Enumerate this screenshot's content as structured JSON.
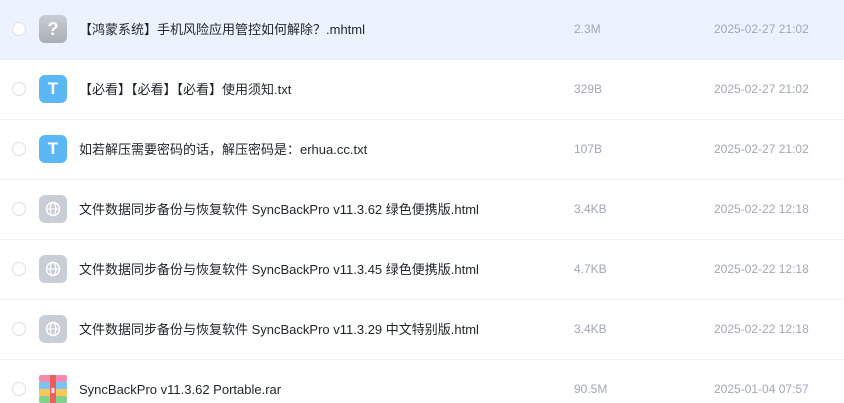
{
  "files": [
    {
      "name": "【鸿蒙系统】手机风险应用管控如何解除？.mhtml",
      "size": "2.3M",
      "date": "2025-02-27 21:02",
      "icon": "unknown-file-icon",
      "icon_glyph": "?"
    },
    {
      "name": "【必看】【必看】【必看】使用须知.txt",
      "size": "329B",
      "date": "2025-02-27 21:02",
      "icon": "txt-file-icon",
      "icon_glyph": "T"
    },
    {
      "name": "如若解压需要密码的话，解压密码是：erhua.cc.txt",
      "size": "107B",
      "date": "2025-02-27 21:02",
      "icon": "txt-file-icon",
      "icon_glyph": "T"
    },
    {
      "name": "文件数据同步备份与恢复软件 SyncBackPro v11.3.62 绿色便携版.html",
      "size": "3.4KB",
      "date": "2025-02-22 12:18",
      "icon": "html-file-icon"
    },
    {
      "name": "文件数据同步备份与恢复软件 SyncBackPro v11.3.45 绿色便携版.html",
      "size": "4.7KB",
      "date": "2025-02-22 12:18",
      "icon": "html-file-icon"
    },
    {
      "name": "文件数据同步备份与恢复软件 SyncBackPro v11.3.29 中文特别版.html",
      "size": "3.4KB",
      "date": "2025-02-22 12:18",
      "icon": "html-file-icon"
    },
    {
      "name": "SyncBackPro v11.3.62 Portable.rar",
      "size": "90.5M",
      "date": "2025-01-04 07:57",
      "icon": "rar-archive-icon"
    }
  ],
  "colors": {
    "selected_row_bg": "#edf3fe",
    "txt_icon": "#5bb8f4",
    "meta_text": "#a1a7b3",
    "name_text": "#1f2329"
  }
}
